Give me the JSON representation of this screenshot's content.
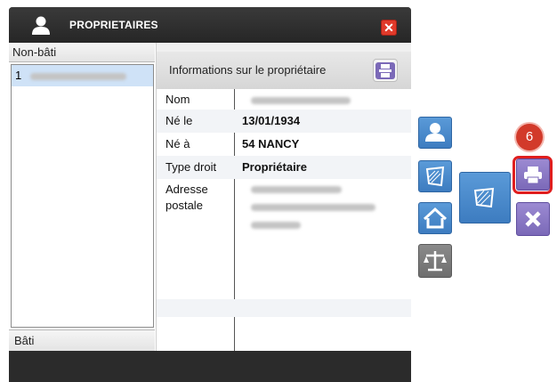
{
  "window": {
    "title": "PROPRIETAIRES",
    "close_label": "✕"
  },
  "left_panel": {
    "header": "Non-bâti",
    "selected_item_index": "1",
    "footer": "Bâti"
  },
  "right_panel": {
    "header": "Informations sur le propriétaire",
    "rows": [
      {
        "label": "Nom",
        "value": ""
      },
      {
        "label": "Né le",
        "value": "13/01/1934"
      },
      {
        "label": "Né à",
        "value": "54 NANCY"
      },
      {
        "label": "Type droit",
        "value": "Propriétaire"
      },
      {
        "label": "Adresse",
        "value": ""
      },
      {
        "label": "postale",
        "value": ""
      }
    ]
  },
  "annotation": {
    "step_number": "6"
  },
  "icons": {
    "title": "user-icon",
    "print": "printer-icon",
    "owner": "user-icon",
    "parcel": "parcel-icon",
    "home": "house-icon",
    "law": "scales-icon",
    "close": "close-icon"
  },
  "colors": {
    "blue_button": "#3d7cc0",
    "purple_button": "#7b69b8",
    "gray_button": "#6e6e6e",
    "highlight": "#e01e1e",
    "close_button": "#e03a2a"
  }
}
